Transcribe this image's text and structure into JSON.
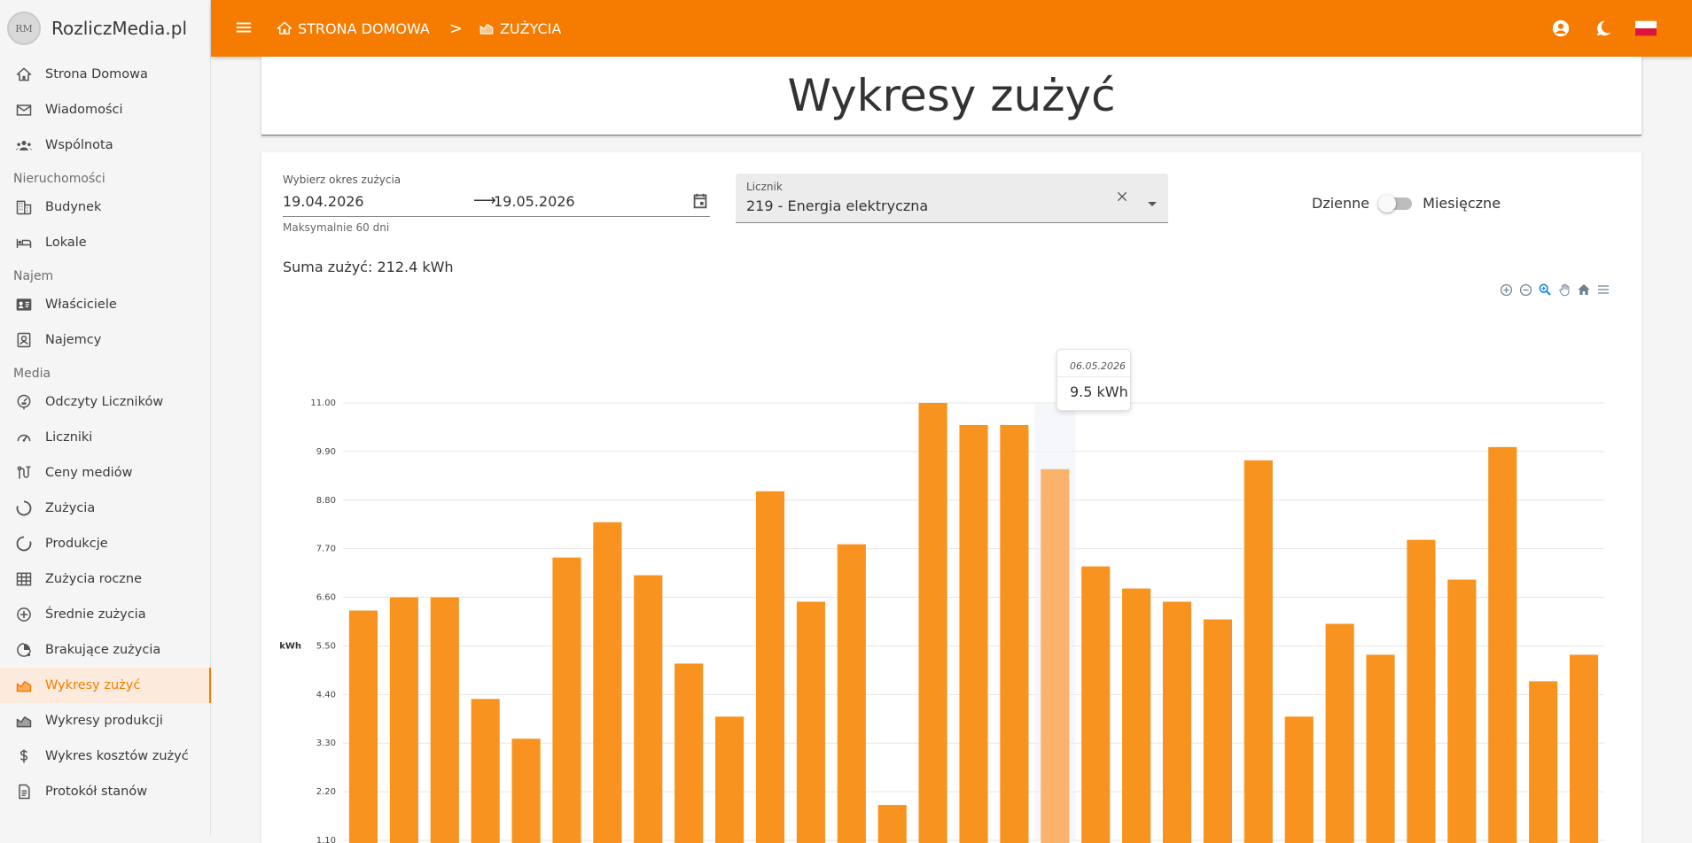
{
  "app": {
    "name": "RozliczMedia.pl",
    "logo_text": "RM"
  },
  "topbar": {
    "crumbs": [
      {
        "label": "STRONA DOMOWA",
        "icon": "home-icon"
      },
      {
        "label": "ZUŻYCIA",
        "icon": "chart-area-icon"
      }
    ],
    "separator": ">",
    "icons": [
      "account-circle-icon",
      "theme-toggle-icon",
      "poland-flag-icon"
    ]
  },
  "sidebar": {
    "items": [
      {
        "label": "Strona Domowa",
        "icon": "home-icon"
      },
      {
        "label": "Wiadomości",
        "icon": "mail-icon"
      },
      {
        "label": "Wspólnota",
        "icon": "community-icon"
      },
      {
        "section": "Nieruchomości"
      },
      {
        "label": "Budynek",
        "icon": "building-icon"
      },
      {
        "label": "Lokale",
        "icon": "bed-icon"
      },
      {
        "section": "Najem"
      },
      {
        "label": "Właściciele",
        "icon": "owner-card-icon"
      },
      {
        "label": "Najemcy",
        "icon": "tenant-icon"
      },
      {
        "section": "Media"
      },
      {
        "label": "Odczyty Liczników",
        "icon": "meter-reading-icon"
      },
      {
        "label": "Liczniki",
        "icon": "gauge-icon"
      },
      {
        "label": "Ceny mediów",
        "icon": "prices-icon"
      },
      {
        "label": "Zużycia",
        "icon": "consumption-icon"
      },
      {
        "label": "Produkcje",
        "icon": "production-icon"
      },
      {
        "label": "Zużycia roczne",
        "icon": "grid-icon"
      },
      {
        "label": "Średnie zużycia",
        "icon": "average-icon"
      },
      {
        "label": "Brakujące zużycia",
        "icon": "missing-icon"
      },
      {
        "label": "Wykresy zużyć",
        "icon": "chart-area-icon",
        "active": true
      },
      {
        "label": "Wykresy produkcji",
        "icon": "chart-area-icon"
      },
      {
        "label": "Wykres kosztów zużyć",
        "icon": "dollar-icon"
      },
      {
        "label": "Protokół stanów",
        "icon": "document-icon"
      }
    ]
  },
  "page": {
    "title": "Wykresy zużyć"
  },
  "filters": {
    "period_label": "Wybierz okres zużycia",
    "date_from": "19.04.2026",
    "arrow": "⟶",
    "date_to": "19.05.2026",
    "period_hint": "Maksymalnie 60 dni",
    "meter_label": "Licznik",
    "meter_value": "219 - Energia elektryczna",
    "toggle_left": "Dzienne",
    "toggle_right": "Miesięczne",
    "toggle_monthly": false
  },
  "summary": {
    "text": "Suma zużyć: 212.4 kWh"
  },
  "tooltip": {
    "date": "06.05.2026",
    "value": "9.5 kWh"
  },
  "colors": {
    "accent": "#f57c00",
    "bar": "#f7931e",
    "bar_highlight": "#fbb26b"
  },
  "chart_data": {
    "type": "bar",
    "ylabel": "kWh",
    "ylim": [
      1.1,
      11.0
    ],
    "yticks": [
      "11.00",
      "9.90",
      "8.80",
      "7.70",
      "6.60",
      "5.50",
      "4.40",
      "3.30",
      "2.20",
      "1.10"
    ],
    "highlight_index": 17,
    "values": [
      6.3,
      6.6,
      6.6,
      4.3,
      3.4,
      7.5,
      8.3,
      7.1,
      5.1,
      3.9,
      9.0,
      6.5,
      7.8,
      1.9,
      11.0,
      10.5,
      10.5,
      9.5,
      7.3,
      6.8,
      6.5,
      6.1,
      9.7,
      3.9,
      6.0,
      5.3,
      7.9,
      7.0,
      10.0,
      4.7,
      5.3
    ]
  }
}
